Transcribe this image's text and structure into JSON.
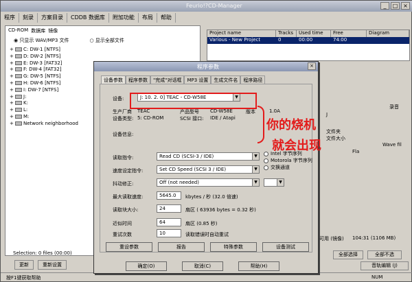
{
  "app": {
    "title": "Feurio!?CD-Manager"
  },
  "menu": [
    "程序",
    "刻录",
    "方案目录",
    "CDDB 数据库",
    "附加功能",
    "布局",
    "帮助"
  ],
  "left": {
    "tabs": [
      "CD-ROM",
      "数据库",
      "镜像"
    ],
    "opt1": "只显示 WAV/MP3 文件",
    "opt2": "显示全部文件",
    "drives": [
      "C: DW-1 [NTFS]",
      "D: DW-2 [NTFS]",
      "E: DW-3 [FAT32]",
      "F: DW-4 [FAT32]",
      "G: DW-5 [NTFS]",
      "H: DW-6 [NTFS]",
      "I: DW-7 [NTFS]",
      "J:",
      "K:",
      "L:",
      "M:",
      "Network neighborhood"
    ],
    "selection": "Selection: 0 files (00:00)",
    "buttons": [
      "更新",
      "重新设置"
    ]
  },
  "right": {
    "headers": [
      "Project name",
      "Tracks",
      "Used time",
      "Free",
      "Diagram"
    ],
    "row": [
      "Various - New Project",
      "0",
      "00:00",
      "74:00",
      ""
    ],
    "snippets": [
      "J",
      "录音",
      "",
      "文件夹",
      "文件大小",
      "",
      "Fla",
      "Wave fil"
    ],
    "bottom_labels": [
      "可用 (镜像)",
      "104:31 (1106 MB)",
      "全部选择",
      "全部不选",
      "音轨编辑 (J)"
    ]
  },
  "dialog": {
    "title": "程序参数",
    "close": "×",
    "tabs": [
      "设备参数",
      "程序参数",
      "\"完成\"对话框",
      "MP3 设置",
      "生成文件名",
      "程序路径"
    ],
    "device_label": "设备:",
    "device_value": "J:  10. 2. 0]  TEAC - CD-W58E",
    "maker_label": "生产厂商",
    "maker_value": "TEAC",
    "product_label": "产品型号",
    "product_value": "CD-W58E",
    "version_label": "版本",
    "version_value": "1.0A",
    "type_label": "设备类型:",
    "type_value": "5: CD-ROM",
    "scsi_label": "SCSI 接口:",
    "scsi_value": "IDE / Atapi",
    "info_label": "设备信息:",
    "read_cmd_label": "读取指令:",
    "read_cmd_value": "Read CD (SCSI-3 / IDE)",
    "speed_cmd_label": "速度设定指令:",
    "speed_cmd_value": "Set CD Speed (SCSI 3 / IDE)",
    "jitter_label": "抖动修正:",
    "jitter_value": "Off (not needed)",
    "max_speed_label": "最大读取速度:",
    "max_speed_value": "5645.0",
    "max_speed_unit": "kbytes / 秒 (32.0 倍速)",
    "block_label": "读取块大小:",
    "block_value": "24",
    "block_unit": "扇区 ( 63936 bytes = 0.32 秒)",
    "overlap_label": "近似时间",
    "overlap_value": "64",
    "overlap_unit": "扇区 (0.85 秒)",
    "retry_label": "重试次数",
    "retry_value": "10",
    "retry_unit": "读取错误时自动重试",
    "radio1": "Intel 字节序列",
    "radio2": "Motorola 字节序列",
    "radio3": "交换通道",
    "btns": [
      "重设参数",
      "报告",
      "特殊参数",
      "设备测试"
    ],
    "ok": "确定(O)",
    "cancel": "取消(C)",
    "help": "帮助(H)"
  },
  "annotation": {
    "line1": "你的烧机",
    "line2": "就会出现"
  },
  "status": {
    "left": "按F1键获取帮助",
    "right": "NUM"
  },
  "colors": {
    "accent": "#0a246a",
    "annotation": "#e31b1b"
  }
}
